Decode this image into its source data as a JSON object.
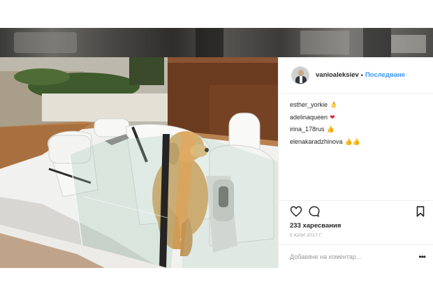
{
  "post": {
    "author": {
      "username": "vanioaleksiev",
      "separator": "•",
      "follow_label": "Последване"
    },
    "comments": [
      {
        "username": "esther_yorkie",
        "emoji": "👌"
      },
      {
        "username": "adelinaqueen",
        "emoji": "❤"
      },
      {
        "username": "irina_178rus",
        "emoji": "👍"
      },
      {
        "username": "elenakaradzhinova",
        "emoji": "👍👍"
      }
    ],
    "actions": {
      "like_icon": "heart-icon",
      "comment_icon": "comment-bubble-icon",
      "save_icon": "bookmark-icon"
    },
    "likes_text": "233 харесвания",
    "date_text": "5 ЮЛИ 2017 Г.",
    "comment_placeholder": "Добавяне на коментар...",
    "more_label": "•••"
  },
  "colors": {
    "link_blue": "#3897f0",
    "text_dark": "#262626",
    "muted_gray": "#999999",
    "heart_red": "#e0242e"
  }
}
